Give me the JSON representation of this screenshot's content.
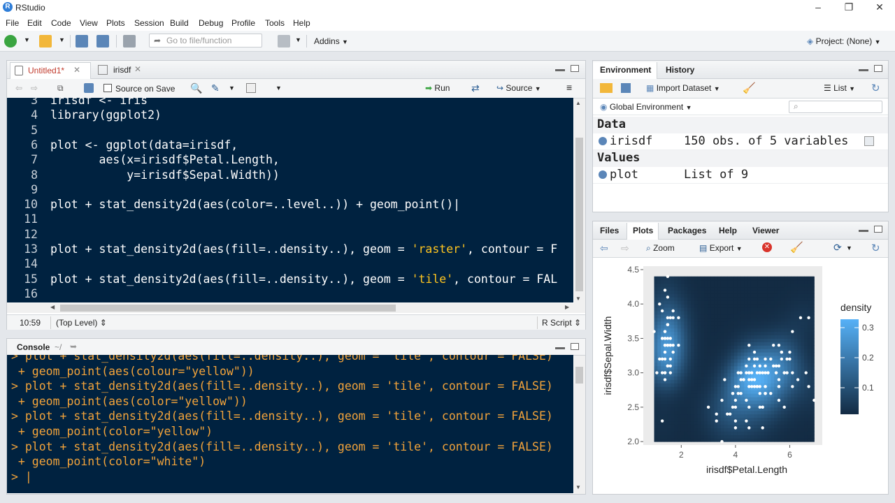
{
  "window": {
    "title": "RStudio",
    "min": "–",
    "restore": "❐",
    "close": "✕"
  },
  "menus": [
    "File",
    "Edit",
    "Code",
    "View",
    "Plots",
    "Session",
    "Build",
    "Debug",
    "Profile",
    "Tools",
    "Help"
  ],
  "toolbar": {
    "goto_placeholder": "Go to file/function",
    "addins": "Addins",
    "project": "Project: (None)"
  },
  "editor": {
    "tabs": [
      {
        "label": "Untitled1*",
        "active": true
      },
      {
        "label": "irisdf",
        "active": false
      }
    ],
    "source_on_save": "Source on Save",
    "run": "Run",
    "source": "Source",
    "lines": [
      {
        "n": "3",
        "text": "irisdf <- iris"
      },
      {
        "n": "4",
        "text": "library(ggplot2)"
      },
      {
        "n": "5",
        "text": ""
      },
      {
        "n": "6",
        "text": "plot <- ggplot(data=irisdf,"
      },
      {
        "n": "7",
        "text": "       aes(x=irisdf$Petal.Length,"
      },
      {
        "n": "8",
        "text": "           y=irisdf$Sepal.Width))"
      },
      {
        "n": "9",
        "text": ""
      },
      {
        "n": "10",
        "text": "plot + stat_density2d(aes(color=..level..)) + geom_point()|"
      },
      {
        "n": "11",
        "text": ""
      },
      {
        "n": "12",
        "text": ""
      },
      {
        "n": "13",
        "text": "plot + stat_density2d(aes(fill=..density..), geom = ",
        "str": "'raster'",
        "rest": ", contour = F"
      },
      {
        "n": "14",
        "text": ""
      },
      {
        "n": "15",
        "text": "plot + stat_density2d(aes(fill=..density..), geom = ",
        "str": "'tile'",
        "rest": ", contour = FAL"
      },
      {
        "n": "16",
        "text": ""
      }
    ],
    "status_pos": "10:59",
    "status_level": "(Top Level) ⇕",
    "status_type": "R Script ⇕"
  },
  "console": {
    "title": "Console",
    "path": "~/",
    "lines": [
      "> plot + stat_density2d(aes(fill=..density..), geom = 'tile', contour = FALSE)",
      " + geom_point(aes(colour=\"yellow\"))",
      "> plot + stat_density2d(aes(fill=..density..), geom = 'tile', contour = FALSE)",
      " + geom_point(aes(color=\"yellow\"))",
      "> plot + stat_density2d(aes(fill=..density..), geom = 'tile', contour = FALSE)",
      " + geom_point(color=\"yellow\")",
      "> plot + stat_density2d(aes(fill=..density..), geom = 'tile', contour = FALSE)",
      " + geom_point(color=\"white\")",
      "> |"
    ]
  },
  "environment": {
    "tabs": [
      "Environment",
      "History"
    ],
    "import": "Import Dataset",
    "list": "List",
    "scope": "Global Environment",
    "data_header": "Data",
    "values_header": "Values",
    "data": [
      {
        "name": "irisdf",
        "value": "150 obs. of 5 variables"
      }
    ],
    "values": [
      {
        "name": "plot",
        "value": "List of 9"
      }
    ]
  },
  "files": {
    "tabs": [
      "Files",
      "Plots",
      "Packages",
      "Help",
      "Viewer"
    ],
    "zoom": "Zoom",
    "export": "Export"
  },
  "chart_data": {
    "type": "heatmap",
    "xlabel": "irisdf$Petal.Length",
    "ylabel": "irisdf$Sepal.Width",
    "xlim": [
      1,
      6.9
    ],
    "ylim": [
      2.0,
      4.4
    ],
    "xticks": [
      "2",
      "4",
      "6"
    ],
    "yticks": [
      "2.0",
      "2.5",
      "3.0",
      "3.5",
      "4.0",
      "4.5"
    ],
    "legend_title": "density",
    "legend_ticks": [
      "0.3",
      "0.2",
      "0.1"
    ],
    "points": [
      [
        1.4,
        3.5
      ],
      [
        1.4,
        3.0
      ],
      [
        1.3,
        3.2
      ],
      [
        1.5,
        3.1
      ],
      [
        1.4,
        3.6
      ],
      [
        1.7,
        3.9
      ],
      [
        1.4,
        3.4
      ],
      [
        1.5,
        3.4
      ],
      [
        1.4,
        2.9
      ],
      [
        1.5,
        3.1
      ],
      [
        1.5,
        3.7
      ],
      [
        1.6,
        3.4
      ],
      [
        1.4,
        3.0
      ],
      [
        1.1,
        3.0
      ],
      [
        1.2,
        4.0
      ],
      [
        1.5,
        4.4
      ],
      [
        1.3,
        3.9
      ],
      [
        1.4,
        3.5
      ],
      [
        1.7,
        3.8
      ],
      [
        1.5,
        3.8
      ],
      [
        1.7,
        3.4
      ],
      [
        1.5,
        3.7
      ],
      [
        1.0,
        3.6
      ],
      [
        1.7,
        3.3
      ],
      [
        1.9,
        3.4
      ],
      [
        1.6,
        3.0
      ],
      [
        1.6,
        3.4
      ],
      [
        1.5,
        3.5
      ],
      [
        1.4,
        3.4
      ],
      [
        1.6,
        3.2
      ],
      [
        1.6,
        3.1
      ],
      [
        1.5,
        3.4
      ],
      [
        1.5,
        4.1
      ],
      [
        1.4,
        4.2
      ],
      [
        1.5,
        3.1
      ],
      [
        1.2,
        3.2
      ],
      [
        1.3,
        3.5
      ],
      [
        1.4,
        3.6
      ],
      [
        1.3,
        3.0
      ],
      [
        1.5,
        3.4
      ],
      [
        1.3,
        3.5
      ],
      [
        1.3,
        2.3
      ],
      [
        1.3,
        3.2
      ],
      [
        1.6,
        3.5
      ],
      [
        1.9,
        3.8
      ],
      [
        1.4,
        3.0
      ],
      [
        1.6,
        3.8
      ],
      [
        1.4,
        3.2
      ],
      [
        1.5,
        3.7
      ],
      [
        1.4,
        3.3
      ],
      [
        4.7,
        3.2
      ],
      [
        4.5,
        3.2
      ],
      [
        4.9,
        3.1
      ],
      [
        4.0,
        2.3
      ],
      [
        4.6,
        2.8
      ],
      [
        4.5,
        2.8
      ],
      [
        4.7,
        3.3
      ],
      [
        3.3,
        2.4
      ],
      [
        4.6,
        2.9
      ],
      [
        3.9,
        2.7
      ],
      [
        3.5,
        2.0
      ],
      [
        4.2,
        3.0
      ],
      [
        4.0,
        2.2
      ],
      [
        4.7,
        2.9
      ],
      [
        3.6,
        2.9
      ],
      [
        4.4,
        3.1
      ],
      [
        4.5,
        3.0
      ],
      [
        4.1,
        2.7
      ],
      [
        4.5,
        2.2
      ],
      [
        3.9,
        2.5
      ],
      [
        4.8,
        3.2
      ],
      [
        4.0,
        2.8
      ],
      [
        4.9,
        2.5
      ],
      [
        4.7,
        2.8
      ],
      [
        4.3,
        2.9
      ],
      [
        4.4,
        3.0
      ],
      [
        4.8,
        2.8
      ],
      [
        5.0,
        3.0
      ],
      [
        4.5,
        2.9
      ],
      [
        3.5,
        2.6
      ],
      [
        3.8,
        2.4
      ],
      [
        3.7,
        2.4
      ],
      [
        3.9,
        2.7
      ],
      [
        5.1,
        2.7
      ],
      [
        4.5,
        3.0
      ],
      [
        4.5,
        3.4
      ],
      [
        4.7,
        3.1
      ],
      [
        4.4,
        2.3
      ],
      [
        4.1,
        3.0
      ],
      [
        4.0,
        2.5
      ],
      [
        4.4,
        2.6
      ],
      [
        4.6,
        3.0
      ],
      [
        4.0,
        2.6
      ],
      [
        3.3,
        2.3
      ],
      [
        4.2,
        2.7
      ],
      [
        4.2,
        3.0
      ],
      [
        4.2,
        2.9
      ],
      [
        4.3,
        2.9
      ],
      [
        3.0,
        2.5
      ],
      [
        4.1,
        2.8
      ],
      [
        6.0,
        3.3
      ],
      [
        5.1,
        2.7
      ],
      [
        5.9,
        3.0
      ],
      [
        5.6,
        2.9
      ],
      [
        5.8,
        3.0
      ],
      [
        6.6,
        3.0
      ],
      [
        4.5,
        2.5
      ],
      [
        6.3,
        2.9
      ],
      [
        5.8,
        2.5
      ],
      [
        6.1,
        3.6
      ],
      [
        5.1,
        3.2
      ],
      [
        5.3,
        2.7
      ],
      [
        5.5,
        3.0
      ],
      [
        5.0,
        2.5
      ],
      [
        5.1,
        2.8
      ],
      [
        5.3,
        3.2
      ],
      [
        5.5,
        3.0
      ],
      [
        6.7,
        3.8
      ],
      [
        6.9,
        2.6
      ],
      [
        5.0,
        2.2
      ],
      [
        5.7,
        3.2
      ],
      [
        4.9,
        2.8
      ],
      [
        6.7,
        2.8
      ],
      [
        4.9,
        2.7
      ],
      [
        5.7,
        3.3
      ],
      [
        6.0,
        3.2
      ],
      [
        4.8,
        2.8
      ],
      [
        4.9,
        3.0
      ],
      [
        5.6,
        2.8
      ],
      [
        5.8,
        3.0
      ],
      [
        6.1,
        2.8
      ],
      [
        6.4,
        3.8
      ],
      [
        5.6,
        2.8
      ],
      [
        5.1,
        2.8
      ],
      [
        5.6,
        2.6
      ],
      [
        6.1,
        3.0
      ],
      [
        5.6,
        3.4
      ],
      [
        5.5,
        3.1
      ],
      [
        4.8,
        3.0
      ],
      [
        5.4,
        3.1
      ],
      [
        5.6,
        3.1
      ],
      [
        5.1,
        3.1
      ],
      [
        5.1,
        2.7
      ],
      [
        5.9,
        3.2
      ],
      [
        5.7,
        3.3
      ],
      [
        5.2,
        3.0
      ],
      [
        5.0,
        2.5
      ],
      [
        5.2,
        3.0
      ],
      [
        5.4,
        3.4
      ],
      [
        5.1,
        3.0
      ]
    ]
  }
}
